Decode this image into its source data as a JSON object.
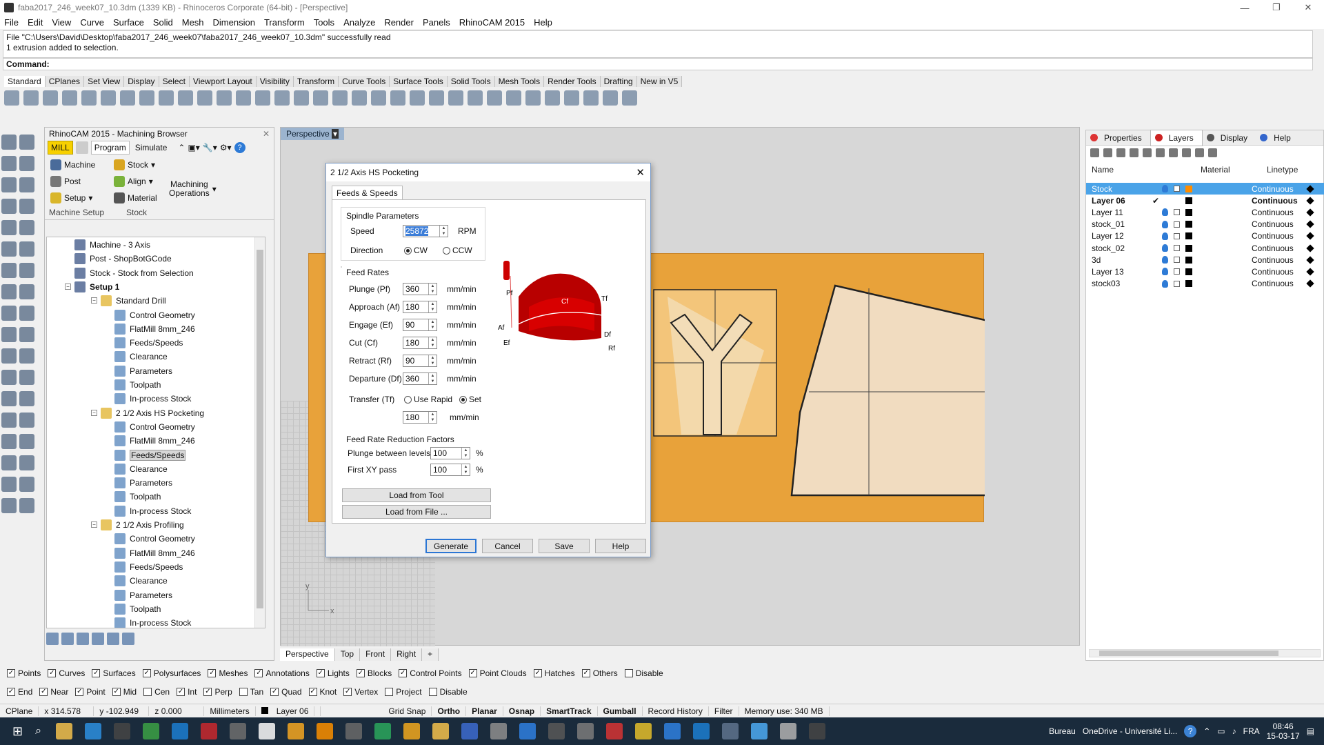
{
  "window": {
    "title": "faba2017_246_week07_10.3dm (1339 KB) - Rhinoceros Corporate (64-bit) - [Perspective]"
  },
  "menu": [
    "File",
    "Edit",
    "View",
    "Curve",
    "Surface",
    "Solid",
    "Mesh",
    "Dimension",
    "Transform",
    "Tools",
    "Analyze",
    "Render",
    "Panels",
    "RhinoCAM 2015",
    "Help"
  ],
  "command": {
    "history_line1": "File \"C:\\Users\\David\\Desktop\\faba2017_246_week07\\faba2017_246_week07_10.3dm\" successfully read",
    "history_line2": "1 extrusion added to selection.",
    "prompt": "Command:"
  },
  "toolbar_tabs": [
    "Standard",
    "CPlanes",
    "Set View",
    "Display",
    "Select",
    "Viewport Layout",
    "Visibility",
    "Transform",
    "Curve Tools",
    "Surface Tools",
    "Solid Tools",
    "Mesh Tools",
    "Render Tools",
    "Drafting",
    "New in V5"
  ],
  "machining_browser": {
    "title": "RhinoCAM 2015 - Machining Browser",
    "mill_label": "MILL",
    "tabs": [
      "Program",
      "Simulate"
    ],
    "buttons": {
      "machine": "Machine",
      "post": "Post",
      "setup": "Setup",
      "stock": "Stock",
      "align": "Align",
      "material": "Material",
      "ops": "Machining\nOperations"
    },
    "groups": {
      "setup": "Machine Setup",
      "stock": "Stock"
    },
    "tree": [
      {
        "label": "Machine - 3 Axis",
        "level": 1
      },
      {
        "label": "Post - ShopBotGCode",
        "level": 1
      },
      {
        "label": "Stock - Stock from Selection",
        "level": 1
      },
      {
        "label": "Setup 1",
        "level": 1,
        "bold": true
      },
      {
        "label": "Standard Drill",
        "level": 2
      },
      {
        "label": "Control Geometry",
        "level": 3
      },
      {
        "label": "FlatMill 8mm_246",
        "level": 3
      },
      {
        "label": "Feeds/Speeds",
        "level": 3
      },
      {
        "label": "Clearance",
        "level": 3
      },
      {
        "label": "Parameters",
        "level": 3
      },
      {
        "label": "Toolpath",
        "level": 3
      },
      {
        "label": "In-process Stock",
        "level": 3
      },
      {
        "label": "2 1/2 Axis HS Pocketing",
        "level": 2
      },
      {
        "label": "Control Geometry",
        "level": 3
      },
      {
        "label": "FlatMill 8mm_246",
        "level": 3
      },
      {
        "label": "Feeds/Speeds",
        "level": 3,
        "selected": true
      },
      {
        "label": "Clearance",
        "level": 3
      },
      {
        "label": "Parameters",
        "level": 3
      },
      {
        "label": "Toolpath",
        "level": 3
      },
      {
        "label": "In-process Stock",
        "level": 3
      },
      {
        "label": "2 1/2 Axis Profiling",
        "level": 2
      },
      {
        "label": "Control Geometry",
        "level": 3
      },
      {
        "label": "FlatMill 8mm_246",
        "level": 3
      },
      {
        "label": "Feeds/Speeds",
        "level": 3
      },
      {
        "label": "Clearance",
        "level": 3
      },
      {
        "label": "Parameters",
        "level": 3
      },
      {
        "label": "Toolpath",
        "level": 3
      },
      {
        "label": "In-process Stock",
        "level": 3
      }
    ]
  },
  "viewport": {
    "name": "Perspective",
    "tabs": [
      "Perspective",
      "Top",
      "Front",
      "Right"
    ],
    "axis_y": "y",
    "axis_x": "x"
  },
  "dialog": {
    "title": "2 1/2 Axis HS Pocketing",
    "tab": "Feeds & Speeds",
    "spindle": {
      "heading": "Spindle Parameters",
      "speed_label": "Speed",
      "speed_value": "25872",
      "speed_unit": "RPM",
      "direction_label": "Direction",
      "cw": "CW",
      "ccw": "CCW"
    },
    "feeds": {
      "heading": "Feed Rates",
      "rows": [
        {
          "label": "Plunge (Pf)",
          "value": "360",
          "unit": "mm/min"
        },
        {
          "label": "Approach (Af)",
          "value": "180",
          "unit": "mm/min"
        },
        {
          "label": "Engage (Ef)",
          "value": "90",
          "unit": "mm/min"
        },
        {
          "label": "Cut (Cf)",
          "value": "180",
          "unit": "mm/min"
        },
        {
          "label": "Retract (Rf)",
          "value": "90",
          "unit": "mm/min"
        },
        {
          "label": "Departure  (Df)",
          "value": "360",
          "unit": "mm/min"
        }
      ],
      "transfer_label": "Transfer (Tf)",
      "use_rapid": "Use Rapid",
      "set": "Set",
      "transfer_value": "180",
      "transfer_unit": "mm/min"
    },
    "diagram_labels": {
      "pf": "Pf",
      "cf": "Cf",
      "tf": "Tf",
      "af": "Af",
      "ef": "Ef",
      "df": "Df",
      "rf": "Rf"
    },
    "reduction": {
      "heading": "Feed Rate Reduction Factors",
      "plunge_label": "Plunge between levels",
      "plunge_value": "100",
      "first_label": "First XY pass",
      "first_value": "100",
      "unit": "%"
    },
    "load_tool": "Load from Tool",
    "load_file": "Load from File ...",
    "buttons": {
      "generate": "Generate",
      "cancel": "Cancel",
      "save": "Save",
      "help": "Help"
    }
  },
  "right_panel": {
    "tabs": [
      "Properties",
      "Layers",
      "Display",
      "Help"
    ],
    "headers": {
      "name": "Name",
      "material": "Material",
      "linetype": "Linetype"
    },
    "layers": [
      {
        "name": "Stock",
        "linetype": "Continuous",
        "selected": true,
        "color": "#ff8c00"
      },
      {
        "name": "Layer 06",
        "linetype": "Continuous",
        "current": true,
        "color": "#000000"
      },
      {
        "name": "Layer 11",
        "linetype": "Continuous",
        "color": "#000000"
      },
      {
        "name": "stock_01",
        "linetype": "Continuous",
        "color": "#000000"
      },
      {
        "name": "Layer 12",
        "linetype": "Continuous",
        "color": "#000000"
      },
      {
        "name": "stock_02",
        "linetype": "Continuous",
        "color": "#000000"
      },
      {
        "name": "3d",
        "linetype": "Continuous",
        "color": "#000000"
      },
      {
        "name": "Layer 13",
        "linetype": "Continuous",
        "color": "#000000"
      },
      {
        "name": "stock03",
        "linetype": "Continuous",
        "color": "#000000"
      }
    ],
    "current_mark": "✔"
  },
  "osnap_filters": [
    "Points",
    "Curves",
    "Surfaces",
    "Polysurfaces",
    "Meshes",
    "Annotations",
    "Lights",
    "Blocks",
    "Control Points",
    "Point Clouds",
    "Hatches",
    "Others",
    "Disable"
  ],
  "osnaps": [
    {
      "label": "End",
      "checked": true
    },
    {
      "label": "Near",
      "checked": true
    },
    {
      "label": "Point",
      "checked": true
    },
    {
      "label": "Mid",
      "checked": true
    },
    {
      "label": "Cen",
      "checked": false
    },
    {
      "label": "Int",
      "checked": true
    },
    {
      "label": "Perp",
      "checked": true
    },
    {
      "label": "Tan",
      "checked": false
    },
    {
      "label": "Quad",
      "checked": true
    },
    {
      "label": "Knot",
      "checked": true
    },
    {
      "label": "Vertex",
      "checked": true
    },
    {
      "label": "Project",
      "checked": false
    },
    {
      "label": "Disable",
      "checked": false
    }
  ],
  "status": {
    "cplane": "CPlane",
    "x": "x 314.578",
    "y": "y -102.949",
    "z": "z 0.000",
    "units": "Millimeters",
    "layer": "Layer 06",
    "grid": "Grid Snap",
    "ortho": "Ortho",
    "planar": "Planar",
    "osnap": "Osnap",
    "smarttrack": "SmartTrack",
    "gumball": "Gumball",
    "history": "Record History",
    "filter": "Filter",
    "memory": "Memory use: 340 MB"
  },
  "taskbar": {
    "bureau": "Bureau",
    "onedrive": "OneDrive - Université Li...",
    "lang": "FRA",
    "time": "08:46",
    "date": "15-03-17"
  }
}
